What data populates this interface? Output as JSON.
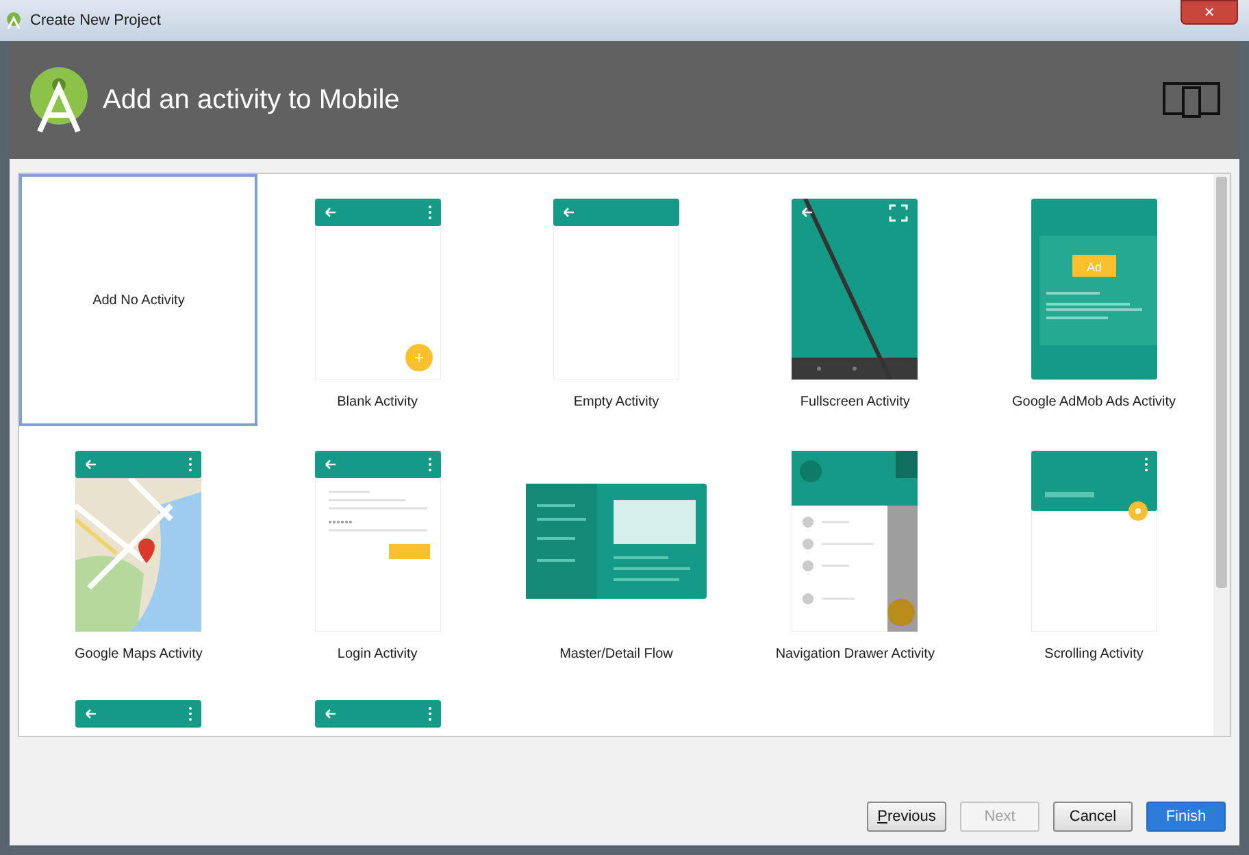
{
  "window": {
    "title": "Create New Project",
    "close": "×"
  },
  "header": {
    "title": "Add an activity to Mobile"
  },
  "templates": [
    {
      "kind": "none",
      "label": "Add No Activity",
      "selected": true
    },
    {
      "kind": "blank",
      "label": "Blank Activity",
      "selected": false
    },
    {
      "kind": "empty",
      "label": "Empty Activity",
      "selected": false
    },
    {
      "kind": "fullscreen",
      "label": "Fullscreen Activity",
      "selected": false
    },
    {
      "kind": "admob",
      "label": "Google AdMob Ads Activity",
      "badge": "Ad",
      "selected": false
    },
    {
      "kind": "maps",
      "label": "Google Maps Activity",
      "selected": false
    },
    {
      "kind": "login",
      "label": "Login Activity",
      "selected": false
    },
    {
      "kind": "masterdetail",
      "label": "Master/Detail Flow",
      "selected": false
    },
    {
      "kind": "drawer",
      "label": "Navigation Drawer Activity",
      "selected": false
    },
    {
      "kind": "scrolling",
      "label": "Scrolling Activity",
      "selected": false
    },
    {
      "kind": "cut"
    },
    {
      "kind": "cut"
    }
  ],
  "buttons": [
    {
      "label": "Previous",
      "kind": "default",
      "disabled": false,
      "mnemonic": true
    },
    {
      "label": "Next",
      "kind": "default",
      "disabled": true,
      "mnemonic": false
    },
    {
      "label": "Cancel",
      "kind": "default",
      "disabled": false,
      "mnemonic": false
    },
    {
      "label": "Finish",
      "kind": "primary",
      "disabled": false,
      "mnemonic": false
    }
  ]
}
